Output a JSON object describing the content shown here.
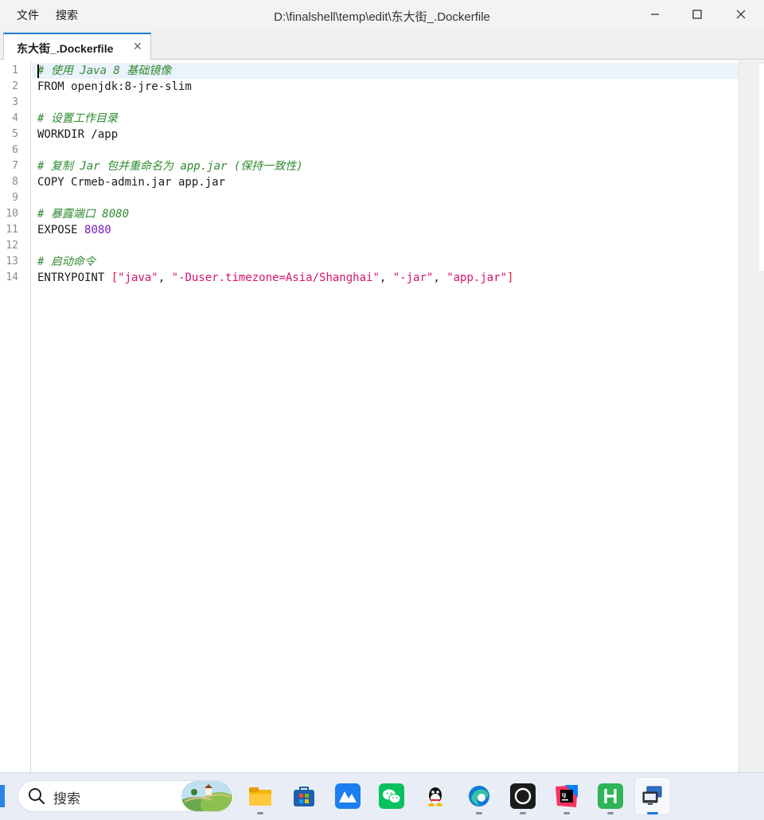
{
  "menu": {
    "file": "文件",
    "search": "搜索"
  },
  "window": {
    "title": "D:\\finalshell\\temp\\edit\\东大街_.Dockerfile",
    "minimize_icon": "minimize-icon",
    "maximize_icon": "maximize-icon",
    "close_icon": "close-icon"
  },
  "tab": {
    "label": "东大街_.Dockerfile",
    "close_glyph": "✕"
  },
  "editor": {
    "line_numbers": [
      "1",
      "2",
      "3",
      "4",
      "5",
      "6",
      "7",
      "8",
      "9",
      "10",
      "11",
      "12",
      "13",
      "14"
    ],
    "lines": [
      [
        {
          "t": "# 使用 Java 8 基础镜像",
          "c": "comment"
        }
      ],
      [
        {
          "t": "FROM openjdk:8-jre-slim",
          "c": "plain"
        }
      ],
      [],
      [
        {
          "t": "# 设置工作目录",
          "c": "comment"
        }
      ],
      [
        {
          "t": "WORKDIR /app",
          "c": "plain"
        }
      ],
      [],
      [
        {
          "t": "# 复制 Jar 包并重命名为 app.jar (保持一致性)",
          "c": "comment"
        }
      ],
      [
        {
          "t": "COPY Crmeb-admin.jar app.jar",
          "c": "plain"
        }
      ],
      [],
      [
        {
          "t": "# 暴露端口 8080",
          "c": "comment"
        }
      ],
      [
        {
          "t": "EXPOSE ",
          "c": "plain"
        },
        {
          "t": "8080",
          "c": "number"
        }
      ],
      [],
      [
        {
          "t": "# 启动命令",
          "c": "comment"
        }
      ],
      [
        {
          "t": "ENTRYPOINT ",
          "c": "plain"
        },
        {
          "t": "[",
          "c": "bracket"
        },
        {
          "t": "\"java\"",
          "c": "string"
        },
        {
          "t": ", ",
          "c": "plain"
        },
        {
          "t": "\"-Duser.timezone=Asia/Shanghai\"",
          "c": "string"
        },
        {
          "t": ", ",
          "c": "plain"
        },
        {
          "t": "\"-jar\"",
          "c": "string"
        },
        {
          "t": ", ",
          "c": "plain"
        },
        {
          "t": "\"app.jar\"",
          "c": "string"
        },
        {
          "t": "]",
          "c": "bracket"
        }
      ]
    ]
  },
  "taskbar": {
    "search_placeholder": "搜索",
    "apps": [
      {
        "icon": "file-explorer-icon",
        "running": true
      },
      {
        "icon": "microsoft-store-icon",
        "running": false
      },
      {
        "icon": "lanhu-icon",
        "running": false
      },
      {
        "icon": "wechat-icon",
        "running": false
      },
      {
        "icon": "qq-icon",
        "running": false
      },
      {
        "icon": "edge-browser-icon",
        "running": true
      },
      {
        "icon": "chatgpt-icon",
        "running": true
      },
      {
        "icon": "intellij-idea-icon",
        "running": true
      },
      {
        "icon": "hbuilderx-icon",
        "running": true
      },
      {
        "icon": "finalshell-icon",
        "running": true,
        "active": true
      }
    ]
  },
  "colors": {
    "accent": "#1f7ad8",
    "comment": "#2e8b2e",
    "number": "#7a18c2",
    "string": "#d6136f",
    "bracket": "#e8182c",
    "current_line": "#eaf2fc"
  }
}
